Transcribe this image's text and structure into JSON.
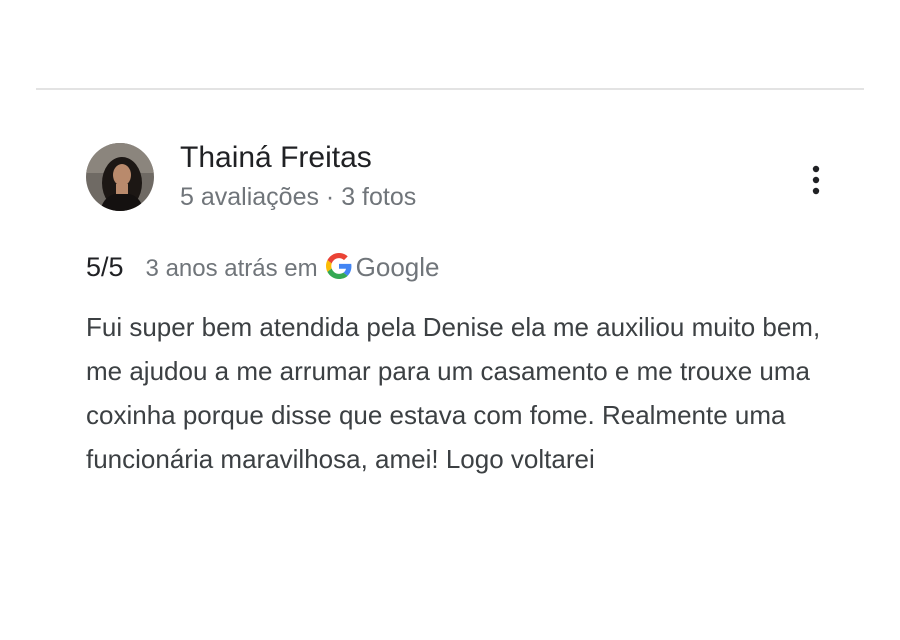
{
  "review": {
    "author": {
      "name": "Thainá Freitas",
      "meta": "5 avaliações · 3 fotos",
      "avatar_icon": "user-photo"
    },
    "more_options_icon": "more-vert-icon",
    "rating": "5/5",
    "time": "3 anos atrás em",
    "source_icon": "google-g-icon",
    "source": "Google",
    "text": "Fui super bem atendida pela Denise ela me auxiliou muito bem, me ajudou a me arrumar para um casamento e me trouxe uma coxinha porque disse que estava com fome. Realmente uma funcionária maravilhosa, amei! Logo voltarei"
  },
  "colors": {
    "name": "#202124",
    "secondary": "#70757a",
    "body_text": "#3c4043",
    "divider": "#e3e3e3",
    "google_blue": "#4285F4",
    "google_red": "#EA4335",
    "google_yellow": "#FBBC05",
    "google_green": "#34A853"
  }
}
